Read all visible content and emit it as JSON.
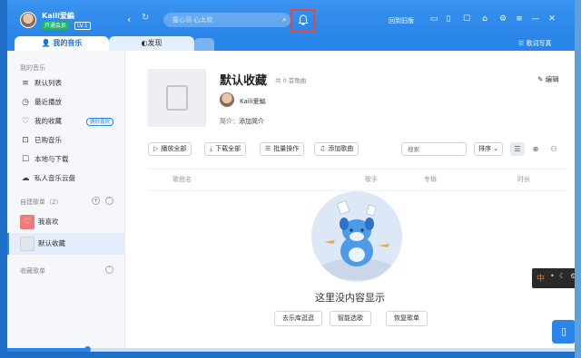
{
  "titlebar": {
    "username": "Kaili爱編",
    "badge_open": "开通会员",
    "badge_level": "LV.1",
    "back_icon": "‹",
    "refresh_icon": "↻",
    "search_placeholder": "靈心羽 心太软",
    "search_icon": "⌕",
    "bell_icon": "🔔",
    "back_to_old": "回到旧版",
    "icons": [
      "▭",
      "▯",
      "☐",
      "⌂",
      "⚙",
      "≡",
      "—",
      "✕"
    ]
  },
  "tabs": {
    "my_music": "我的音乐",
    "discover": "发现",
    "lyrics": "歌词写真"
  },
  "sidebar": {
    "my_music_title": "我的音乐",
    "items": [
      {
        "icon": "≡",
        "label": "默认列表"
      },
      {
        "icon": "◷",
        "label": "最近播放"
      },
      {
        "icon": "♡",
        "label": "我的收藏",
        "pill": "猜你喜欢"
      },
      {
        "icon": "⊡",
        "label": "已购音乐"
      },
      {
        "icon": "☐",
        "label": "本地与下载"
      },
      {
        "icon": "☁",
        "label": "私人音乐云盘"
      }
    ],
    "created_title": "自建歌单（2）",
    "created": [
      {
        "label": "我喜欢",
        "color": "#f07a7a"
      },
      {
        "label": "默认收藏",
        "color": "#e5e7eb"
      }
    ],
    "collected_title": "收藏歌单"
  },
  "playlist": {
    "title": "默认收藏",
    "count": "共 0 首歌曲",
    "edit": "编辑",
    "owner": "Kaili爱編",
    "intro_label": "简介：",
    "intro_value": "添加简介",
    "actions": [
      "播放全部",
      "下载全部",
      "批量操作",
      "添加歌曲"
    ],
    "action_icons": [
      "▷",
      "⤓",
      "☰",
      "♫"
    ],
    "filter_placeholder": "搜索",
    "sort_label": "排序 ⌄",
    "columns": [
      "歌曲名",
      "歌手",
      "专辑",
      "时长"
    ],
    "empty_text": "这里没内容显示",
    "empty_buttons": [
      "去乐库逛逛",
      "智能选歌",
      "恢复歌单"
    ]
  },
  "player": {
    "progress": 0.14
  },
  "ime": {
    "label": "中"
  },
  "colors": {
    "accent": "#2a85e8",
    "highlight": "#e2483f"
  }
}
